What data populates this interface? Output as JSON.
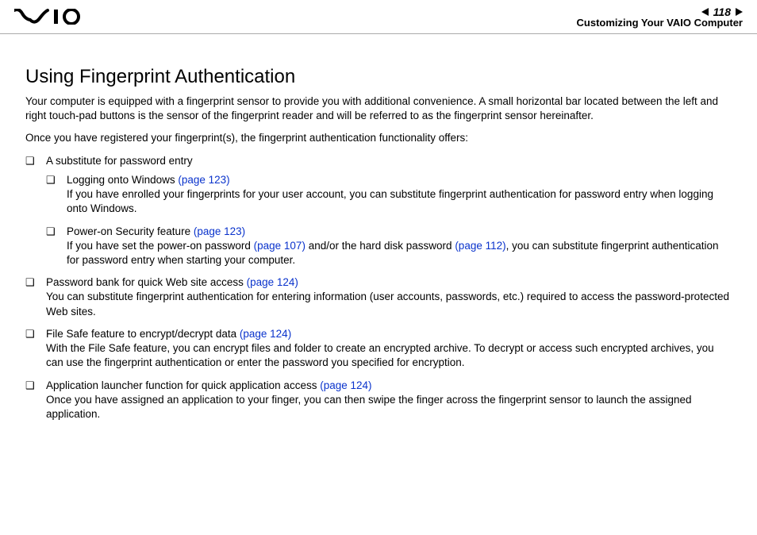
{
  "header": {
    "page_number": "118",
    "section": "Customizing Your VAIO Computer",
    "prev_aria": "Previous page",
    "next_aria": "Next page"
  },
  "title": "Using Fingerprint Authentication",
  "intro1": "Your computer is equipped with a fingerprint sensor to provide you with additional convenience. A small horizontal bar located between the left and right touch-pad buttons is the sensor of the fingerprint reader and will be referred to as the fingerprint sensor hereinafter.",
  "intro2": "Once you have registered your fingerprint(s), the fingerprint authentication functionality offers:",
  "items": {
    "pw_sub": "A substitute for password entry",
    "logon": {
      "lead": "Logging onto Windows ",
      "xref": "(page 123)",
      "body": "If you have enrolled your fingerprints for your user account, you can substitute fingerprint authentication for password entry when logging onto Windows."
    },
    "poweron": {
      "lead": "Power-on Security feature ",
      "xref": "(page 123)",
      "body1": "If you have set the power-on password ",
      "xref_pw": "(page 107)",
      "body2": " and/or the hard disk password ",
      "xref_hd": "(page 112)",
      "body3": ", you can substitute fingerprint authentication for password entry when starting your computer."
    },
    "pwbank": {
      "lead": "Password bank for quick Web site access ",
      "xref": "(page 124)",
      "body": "You can substitute fingerprint authentication for entering information (user accounts, passwords, etc.) required to access the password-protected Web sites."
    },
    "filesafe": {
      "lead": "File Safe feature to encrypt/decrypt data ",
      "xref": "(page 124)",
      "body": "With the File Safe feature, you can encrypt files and folder to create an encrypted archive. To decrypt or access such encrypted archives, you can use the fingerprint authentication or enter the password you specified for encryption."
    },
    "launcher": {
      "lead": "Application launcher function for quick application access ",
      "xref": "(page 124)",
      "body": "Once you have assigned an application to your finger, you can then swipe the finger across the fingerprint sensor to launch the assigned application."
    }
  }
}
